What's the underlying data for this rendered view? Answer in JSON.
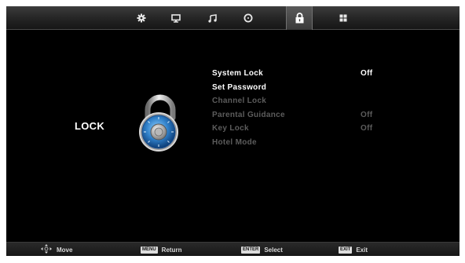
{
  "top_tabs": [
    {
      "icon": "gear-icon",
      "active": false
    },
    {
      "icon": "monitor-icon",
      "active": false
    },
    {
      "icon": "music-note-icon",
      "active": false
    },
    {
      "icon": "clock-icon",
      "active": false
    },
    {
      "icon": "lock-icon",
      "active": true
    },
    {
      "icon": "grid-icon",
      "active": false
    }
  ],
  "section": {
    "title": "LOCK",
    "graphic": "combination-padlock-icon"
  },
  "menu": {
    "items": [
      {
        "label": "System Lock",
        "value": "Off",
        "enabled": true
      },
      {
        "label": "Set Password",
        "value": "",
        "enabled": true
      },
      {
        "label": "Channel Lock",
        "value": "",
        "enabled": false
      },
      {
        "label": "Parental Guidance",
        "value": "Off",
        "enabled": false
      },
      {
        "label": "Key Lock",
        "value": "Off",
        "enabled": false
      },
      {
        "label": "Hotel Mode",
        "value": "",
        "enabled": false
      }
    ]
  },
  "bottom_hints": {
    "move": {
      "key": "",
      "label": "Move"
    },
    "return": {
      "key": "MENU",
      "label": "Return"
    },
    "select": {
      "key": "ENTER",
      "label": "Select"
    },
    "exit": {
      "key": "EXIT",
      "label": "Exit"
    }
  },
  "colors": {
    "background": "#000000",
    "text_enabled": "#ffffff",
    "text_disabled": "#5c5c5c",
    "lock_blue": "#2f7fc8"
  }
}
